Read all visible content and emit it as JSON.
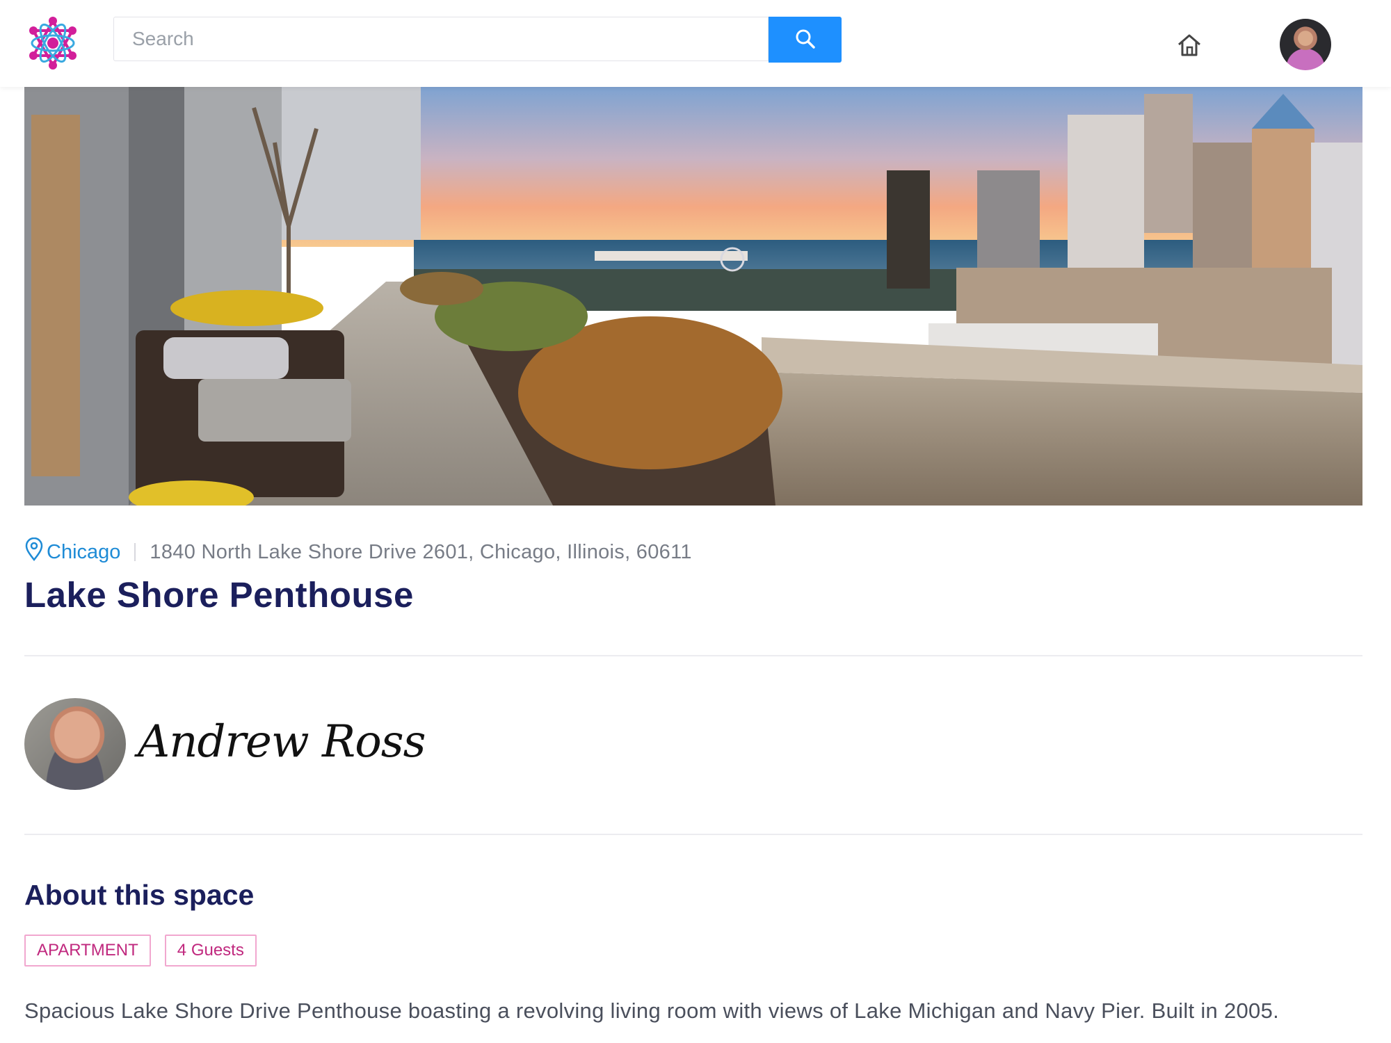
{
  "header": {
    "search_placeholder": "Search",
    "logo_icon": "atom-network-logo",
    "search_icon": "magnifier-icon",
    "home_icon": "home-icon",
    "user_avatar": "user-avatar"
  },
  "hero": {
    "image": "chicago-penthouse-terrace-skyline-photo"
  },
  "listing": {
    "city": "Chicago",
    "address": "1840 North Lake Shore Drive 2601, Chicago, Illinois, 60611",
    "title": "Lake Shore Penthouse"
  },
  "host": {
    "name": "Andrew Ross"
  },
  "about": {
    "heading": "About this space",
    "tags": [
      "APARTMENT",
      "4 Guests"
    ],
    "description": "Spacious Lake Shore Drive Penthouse boasting a revolving living room with views of Lake Michigan and Navy Pier. Built in 2005."
  },
  "colors": {
    "accent": "#1e90ff",
    "title": "#1b1f5c",
    "city_link": "#1e8bd6",
    "tag_border": "#f1a7cf",
    "tag_text": "#c0287e"
  }
}
